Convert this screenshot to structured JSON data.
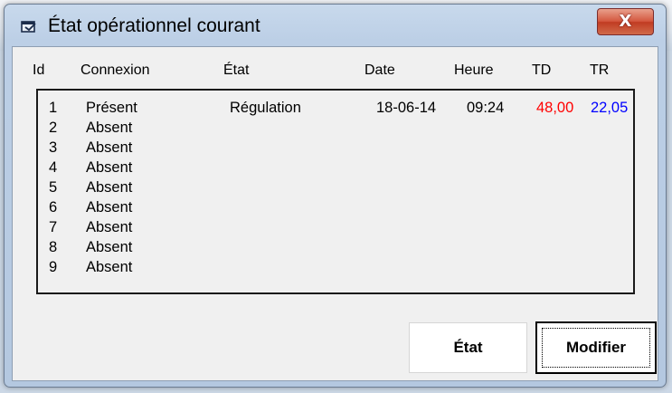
{
  "window": {
    "title": "État opérationnel courant",
    "close_glyph": "X"
  },
  "columns": {
    "id": "Id",
    "connexion": "Connexion",
    "etat": "État",
    "date": "Date",
    "heure": "Heure",
    "td": "TD",
    "tr": "TR"
  },
  "rows": [
    {
      "id": "1",
      "connexion": "Présent",
      "etat": "Régulation",
      "date": "18-06-14",
      "heure": "09:24",
      "td": "48,00",
      "tr": "22,05"
    },
    {
      "id": "2",
      "connexion": "Absent"
    },
    {
      "id": "3",
      "connexion": "Absent"
    },
    {
      "id": "4",
      "connexion": "Absent"
    },
    {
      "id": "5",
      "connexion": "Absent"
    },
    {
      "id": "6",
      "connexion": "Absent"
    },
    {
      "id": "7",
      "connexion": "Absent"
    },
    {
      "id": "8",
      "connexion": "Absent"
    },
    {
      "id": "9",
      "connexion": "Absent"
    }
  ],
  "buttons": {
    "etat": "État",
    "modifier": "Modifier"
  },
  "colors": {
    "td_value": "#ff0000",
    "tr_value": "#0000ff",
    "close_button": "#c13c22"
  },
  "icons": {
    "title": "window-app-icon",
    "close": "close-icon"
  }
}
